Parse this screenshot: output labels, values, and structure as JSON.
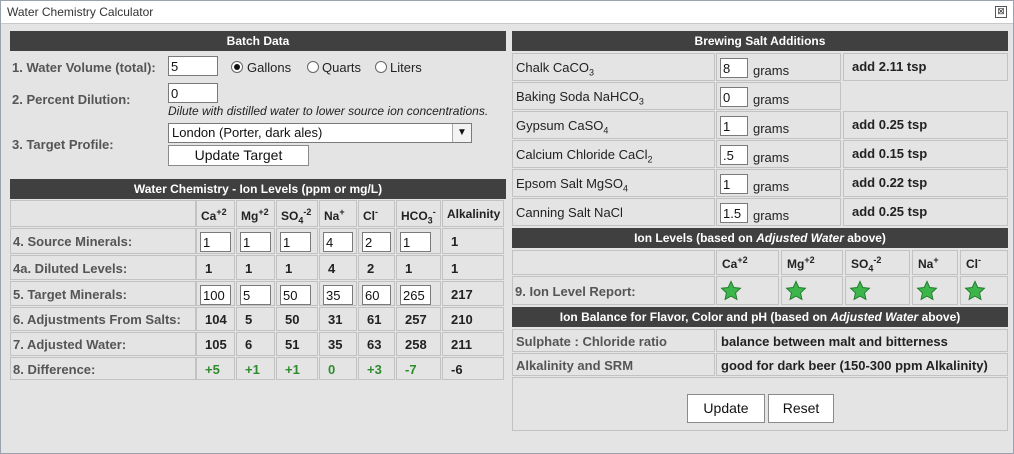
{
  "window": {
    "title": "Water Chemistry Calculator",
    "close_glyph": "⊠"
  },
  "batch": {
    "header": "Batch Data",
    "volume_label": "1. Water Volume (total):",
    "volume_value": "5",
    "units": [
      "Gallons",
      "Quarts",
      "Liters"
    ],
    "selected_unit": "Gallons",
    "dilution_label": "2. Percent Dilution:",
    "dilution_value": "0",
    "dilution_note": "Dilute with distilled water to lower source ion concentrations.",
    "target_label": "3. Target Profile:",
    "target_value": "London (Porter, dark ales)",
    "update_target": "Update Target"
  },
  "ion": {
    "header": "Water Chemistry - Ion Levels (ppm or mg/L)",
    "columns": [
      {
        "base": "Ca",
        "sup": "+2",
        "sub": ""
      },
      {
        "base": "Mg",
        "sup": "+2",
        "sub": ""
      },
      {
        "base": "SO",
        "sub": "4",
        "sup": "-2"
      },
      {
        "base": "Na",
        "sup": "+",
        "sub": ""
      },
      {
        "base": "Cl",
        "sup": "-",
        "sub": ""
      },
      {
        "base": "HCO",
        "sub": "3",
        "sup": "-"
      },
      {
        "base": "Alkalinity",
        "sup": "",
        "sub": ""
      }
    ],
    "rows": [
      {
        "label": "4. Source Minerals:",
        "values": [
          "1",
          "1",
          "1",
          "4",
          "2",
          "1",
          "1"
        ],
        "inputs": true
      },
      {
        "label": "4a. Diluted Levels:",
        "values": [
          "1",
          "1",
          "1",
          "4",
          "2",
          "1",
          "1"
        ],
        "inputs": false
      },
      {
        "label": "5. Target Minerals:",
        "values": [
          "100",
          "5",
          "50",
          "35",
          "60",
          "265",
          "217"
        ],
        "inputs": true
      },
      {
        "label": "6. Adjustments From Salts:",
        "values": [
          "104",
          "5",
          "50",
          "31",
          "61",
          "257",
          "210"
        ],
        "inputs": false
      },
      {
        "label": "7. Adjusted Water:",
        "values": [
          "105",
          "6",
          "51",
          "35",
          "63",
          "258",
          "211"
        ],
        "inputs": false
      },
      {
        "label": "8. Difference:",
        "values": [
          "+5",
          "+1",
          "+1",
          "0",
          "+3",
          "-7",
          "-6"
        ],
        "inputs": false,
        "green": true
      }
    ]
  },
  "salts": {
    "header": "Brewing Salt Additions",
    "unit": "grams",
    "items": [
      {
        "name": "Chalk CaCO",
        "sub": "3",
        "value": "8",
        "add": "add 2.11 tsp"
      },
      {
        "name": "Baking Soda NaHCO",
        "sub": "3",
        "value": "0",
        "add": ""
      },
      {
        "name": "Gypsum CaSO",
        "sub": "4",
        "value": "1",
        "add": "add 0.25 tsp"
      },
      {
        "name": "Calcium Chloride CaCl",
        "sub": "2",
        "value": ".5",
        "add": "add 0.15 tsp"
      },
      {
        "name": "Epsom Salt MgSO",
        "sub": "4",
        "value": "1",
        "add": "add 0.22 tsp"
      },
      {
        "name": "Canning Salt NaCl",
        "sub": "",
        "value": "1.5",
        "add": "add 0.25 tsp"
      }
    ]
  },
  "levels": {
    "header_pre": "Ion Levels (based on ",
    "header_em": "Adjusted Water",
    "header_post": " above)",
    "report_label": "9. Ion Level Report:",
    "columns": [
      {
        "base": "Ca",
        "sup": "+2",
        "sub": ""
      },
      {
        "base": "Mg",
        "sup": "+2",
        "sub": ""
      },
      {
        "base": "SO",
        "sub": "4",
        "sup": "-2"
      },
      {
        "base": "Na",
        "sup": "+",
        "sub": ""
      },
      {
        "base": "Cl",
        "sup": "-",
        "sub": ""
      }
    ],
    "star_color": "#3cb54a"
  },
  "balance": {
    "header_pre": "Ion Balance for Flavor, Color and pH (based on ",
    "header_em": "Adjusted Water",
    "header_post": " above)",
    "rows": [
      {
        "label": "Sulphate : Chloride ratio",
        "value": "balance between malt and bitterness"
      },
      {
        "label": "Alkalinity and SRM",
        "value": "good for dark beer (150-300 ppm Alkalinity)"
      }
    ],
    "update": "Update",
    "reset": "Reset"
  }
}
